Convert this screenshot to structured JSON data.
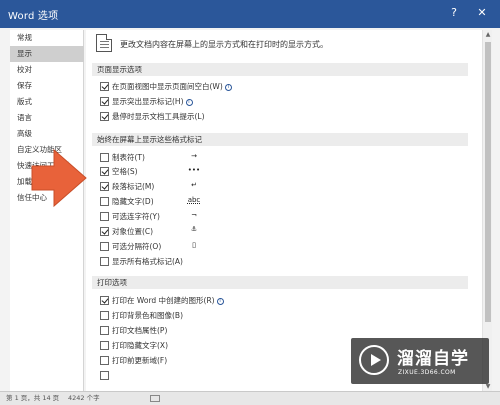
{
  "window": {
    "title": "Word 选项",
    "help": "?",
    "close": "✕"
  },
  "sidebar": {
    "items": [
      {
        "label": "常规"
      },
      {
        "label": "显示",
        "active": true
      },
      {
        "label": "校对"
      },
      {
        "label": "保存"
      },
      {
        "label": "版式"
      },
      {
        "label": "语言"
      },
      {
        "label": "高级"
      },
      {
        "label": "自定义功能区"
      },
      {
        "label": "快速访问工具栏"
      },
      {
        "label": "加载项"
      },
      {
        "label": "信任中心"
      }
    ]
  },
  "main": {
    "intro": "更改文档内容在屏幕上的显示方式和在打印时的显示方式。",
    "sections": [
      {
        "title": "页面显示选项",
        "options": [
          {
            "label": "在页面视图中显示页面间空白(W)",
            "checked": true,
            "info": true
          },
          {
            "label": "显示突出显示标记(H)",
            "checked": true,
            "info": true
          },
          {
            "label": "悬停时显示文档工具提示(L)",
            "checked": true
          }
        ]
      },
      {
        "title": "始终在屏幕上显示这些格式标记",
        "options": [
          {
            "label": "制表符(T)",
            "checked": false,
            "symbol": "→"
          },
          {
            "label": "空格(S)",
            "checked": true,
            "symbol": "•••"
          },
          {
            "label": "段落标记(M)",
            "checked": true,
            "symbol": "↵"
          },
          {
            "label": "隐藏文字(D)",
            "checked": false,
            "symbol": "abc"
          },
          {
            "label": "可选连字符(Y)",
            "checked": false,
            "symbol": "¬"
          },
          {
            "label": "对象位置(C)",
            "checked": true,
            "symbol": "⚓"
          },
          {
            "label": "可选分隔符(O)",
            "checked": false,
            "symbol": "▯"
          },
          {
            "label": "显示所有格式标记(A)",
            "checked": false
          }
        ]
      },
      {
        "title": "打印选项",
        "options": [
          {
            "label": "打印在 Word 中创建的图形(R)",
            "checked": true,
            "info": true
          },
          {
            "label": "打印背景色和图像(B)",
            "checked": false
          },
          {
            "label": "打印文档属性(P)",
            "checked": false
          },
          {
            "label": "打印隐藏文字(X)",
            "checked": false
          },
          {
            "label": "打印前更新域(F)",
            "checked": false
          }
        ]
      }
    ]
  },
  "statusbar": {
    "page": "第 1 页，共 14 页",
    "words": "4242 个字"
  },
  "watermark": {
    "name": "溜溜自学",
    "url": "ZIXUE.3D66.COM"
  },
  "colors": {
    "titlebar": "#2b579a",
    "arrow": "#e8623a"
  },
  "icons": {
    "help": "question-mark",
    "close": "x-mark",
    "scroll_up": "triangle-up",
    "scroll_down": "triangle-down"
  }
}
